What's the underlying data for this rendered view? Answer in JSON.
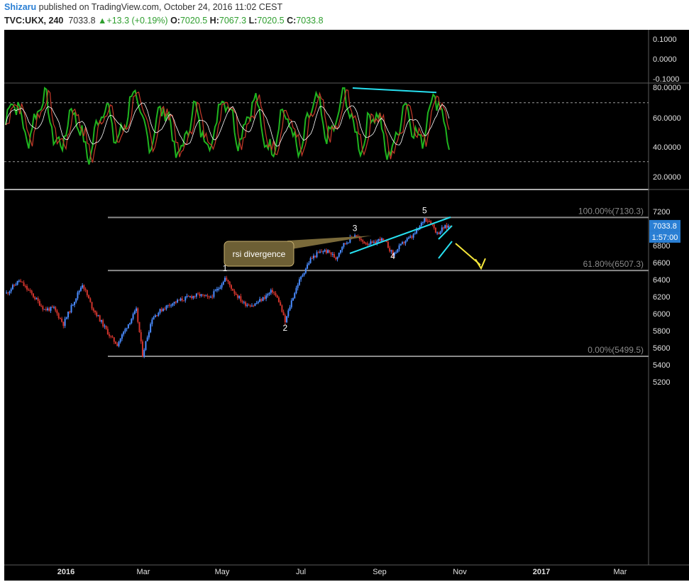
{
  "header": {
    "author": "Shizaru",
    "published_text": "published on TradingView.com, October 24, 2016 11:02 CEST",
    "symbol": "TVC:UKX, 240",
    "last": "7033.8",
    "arrow": "▲",
    "change": "+13.3 (+0.19%)",
    "o_label": "O:",
    "o_value": "7020.5",
    "h_label": "H:",
    "h_value": "7067.3",
    "l_label": "L:",
    "l_value": "7020.5",
    "c_label": "C:",
    "c_value": "7033.8"
  },
  "colors": {
    "background": "#000000",
    "up_candle": "#4a8cff",
    "down_candle": "#d0342c",
    "rsi_green": "#1fb51f",
    "rsi_red": "#c83a2a",
    "rsi_signal": "#ffffff",
    "trendline": "#27e0f0",
    "forecast_arrow": "#f5e63a",
    "fib_line": "#8a8a8a",
    "price_tag": "#2a7fd4",
    "callout": "#7a6a3a"
  },
  "chart_data": [
    {
      "type": "line",
      "name": "rsi-panel",
      "yticks": [
        "0.1000",
        "0.0000",
        "-0.1000",
        "80.0000",
        "60.0000",
        "40.0000",
        "20.0000"
      ],
      "upper_level": 70,
      "lower_level": 30,
      "divergence_line": {
        "from": 80,
        "to": 77
      }
    },
    {
      "type": "candlestick",
      "name": "UKX 240",
      "ylim": [
        5100,
        7300
      ],
      "yticks": [
        7200,
        7000,
        6800,
        6600,
        6400,
        6200,
        6000,
        5800,
        5600,
        5400,
        5200
      ],
      "xticks": [
        "2016",
        "Mar",
        "May",
        "Jul",
        "Sep",
        "Nov",
        "2017",
        "Mar"
      ],
      "close_path": [
        {
          "t": 0,
          "v": 6240
        },
        {
          "t": 4,
          "v": 6390
        },
        {
          "t": 8,
          "v": 6230
        },
        {
          "t": 12,
          "v": 6050
        },
        {
          "t": 15,
          "v": 6060
        },
        {
          "t": 18,
          "v": 5880
        },
        {
          "t": 21,
          "v": 6120
        },
        {
          "t": 24,
          "v": 6350
        },
        {
          "t": 27,
          "v": 6080
        },
        {
          "t": 30,
          "v": 5900
        },
        {
          "t": 33,
          "v": 5720
        },
        {
          "t": 35,
          "v": 5640
        },
        {
          "t": 38,
          "v": 5850
        },
        {
          "t": 41,
          "v": 6040
        },
        {
          "t": 43,
          "v": 5520
        },
        {
          "t": 46,
          "v": 5950
        },
        {
          "t": 49,
          "v": 6050
        },
        {
          "t": 52,
          "v": 6120
        },
        {
          "t": 55,
          "v": 6160
        },
        {
          "t": 58,
          "v": 6200
        },
        {
          "t": 61,
          "v": 6220
        },
        {
          "t": 64,
          "v": 6180
        },
        {
          "t": 67,
          "v": 6300
        },
        {
          "t": 69,
          "v": 6420
        },
        {
          "t": 72,
          "v": 6250
        },
        {
          "t": 75,
          "v": 6120
        },
        {
          "t": 78,
          "v": 6100
        },
        {
          "t": 81,
          "v": 6180
        },
        {
          "t": 84,
          "v": 6270
        },
        {
          "t": 86,
          "v": 6150
        },
        {
          "t": 88,
          "v": 5900
        },
        {
          "t": 90,
          "v": 6150
        },
        {
          "t": 92,
          "v": 6350
        },
        {
          "t": 94,
          "v": 6500
        },
        {
          "t": 96,
          "v": 6640
        },
        {
          "t": 98,
          "v": 6700
        },
        {
          "t": 100,
          "v": 6740
        },
        {
          "t": 102,
          "v": 6720
        },
        {
          "t": 104,
          "v": 6650
        },
        {
          "t": 106,
          "v": 6800
        },
        {
          "t": 108,
          "v": 6860
        },
        {
          "t": 110,
          "v": 6930
        },
        {
          "t": 112,
          "v": 6850
        },
        {
          "t": 114,
          "v": 6830
        },
        {
          "t": 116,
          "v": 6820
        },
        {
          "t": 118,
          "v": 6880
        },
        {
          "t": 120,
          "v": 6820
        },
        {
          "t": 122,
          "v": 6690
        },
        {
          "t": 124,
          "v": 6780
        },
        {
          "t": 126,
          "v": 6860
        },
        {
          "t": 128,
          "v": 6900
        },
        {
          "t": 130,
          "v": 6990
        },
        {
          "t": 132,
          "v": 7120
        },
        {
          "t": 134,
          "v": 7080
        },
        {
          "t": 136,
          "v": 6940
        },
        {
          "t": 138,
          "v": 7010
        },
        {
          "t": 140,
          "v": 7033.8
        }
      ],
      "current_price": "7033.8",
      "countdown": "1:57:00",
      "fib_levels": [
        {
          "label": "100.00%(7130.3)",
          "value": 7130.3
        },
        {
          "label": "61.80%(6507.3)",
          "value": 6507.3
        },
        {
          "label": "0.00%(5499.5)",
          "value": 5499.5
        }
      ],
      "wave_labels": [
        {
          "label": "1",
          "t": 69,
          "v": 6500
        },
        {
          "label": "2",
          "t": 88,
          "v": 5800
        },
        {
          "label": "3",
          "t": 110,
          "v": 6970
        },
        {
          "label": "4",
          "t": 122,
          "v": 6640
        },
        {
          "label": "5",
          "t": 132,
          "v": 7180
        }
      ],
      "annotation": "rsi divergence",
      "forecast_target": 6540
    }
  ]
}
